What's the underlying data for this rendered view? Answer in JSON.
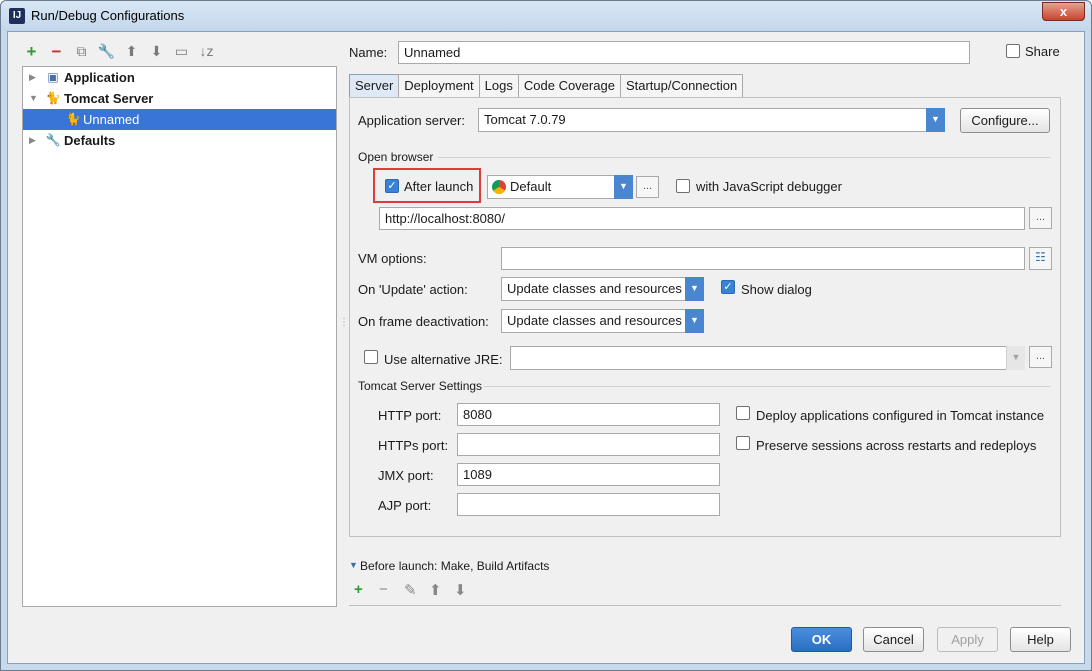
{
  "window": {
    "title": "Run/Debug Configurations",
    "close_label": "x"
  },
  "tree": [
    {
      "label": "Application",
      "arrow": "▶",
      "icon": "▣"
    },
    {
      "label": "Tomcat Server",
      "arrow": "▼",
      "icon": "🐈"
    },
    {
      "label": "Unnamed",
      "arrow": "",
      "icon": "🐈"
    },
    {
      "label": "Defaults",
      "arrow": "▶",
      "icon": "🔧"
    }
  ],
  "toolbar": {
    "add": "+",
    "remove": "−",
    "copy": "⧉",
    "edit": "🔧",
    "up": "⬆",
    "down": "⬇",
    "folder": "▭",
    "sort": "↓z"
  },
  "config": {
    "name_label": "Name:",
    "name_value": "Unnamed",
    "share_label": "Share",
    "share_checked": false
  },
  "tabs": [
    "Server",
    "Deployment",
    "Logs",
    "Code Coverage",
    "Startup/Connection"
  ],
  "server": {
    "app_server_label": "Application server:",
    "app_server_value": "Tomcat 7.0.79",
    "configure_label": "Configure...",
    "open_browser_label": "Open browser",
    "after_launch_label": "After launch",
    "after_launch_checked": true,
    "browser_value": "Default",
    "js_debugger_label": "with JavaScript debugger",
    "js_debugger_checked": false,
    "url_value": "http://localhost:8080/",
    "vm_options_label": "VM options:",
    "vm_options_value": "",
    "update_action_label": "On 'Update' action:",
    "update_action_value": "Update classes and resources",
    "show_dialog_label": "Show dialog",
    "show_dialog_checked": true,
    "frame_deactivation_label": "On frame deactivation:",
    "frame_deactivation_value": "Update classes and resources",
    "alt_jre_label": "Use alternative JRE:",
    "alt_jre_checked": false,
    "alt_jre_value": "",
    "tomcat_settings_label": "Tomcat Server Settings",
    "http_port_label": "HTTP port:",
    "http_port_value": "8080",
    "https_port_label": "HTTPs port:",
    "https_port_value": "",
    "jmx_port_label": "JMX port:",
    "jmx_port_value": "1089",
    "ajp_port_label": "AJP port:",
    "ajp_port_value": "",
    "deploy_apps_label": "Deploy applications configured in Tomcat instance",
    "deploy_apps_checked": false,
    "preserve_sessions_label": "Preserve sessions across restarts and redeploys",
    "preserve_sessions_checked": false,
    "dots": "..."
  },
  "before_launch": {
    "label": "Before launch: Make, Build Artifacts",
    "tools": [
      "+",
      "−",
      "✎",
      "⬆",
      "⬇"
    ]
  },
  "buttons": {
    "ok": "OK",
    "cancel": "Cancel",
    "apply": "Apply",
    "help": "Help"
  },
  "colors": {
    "accent": "#3875d7",
    "highlight": "#e03a3a"
  }
}
